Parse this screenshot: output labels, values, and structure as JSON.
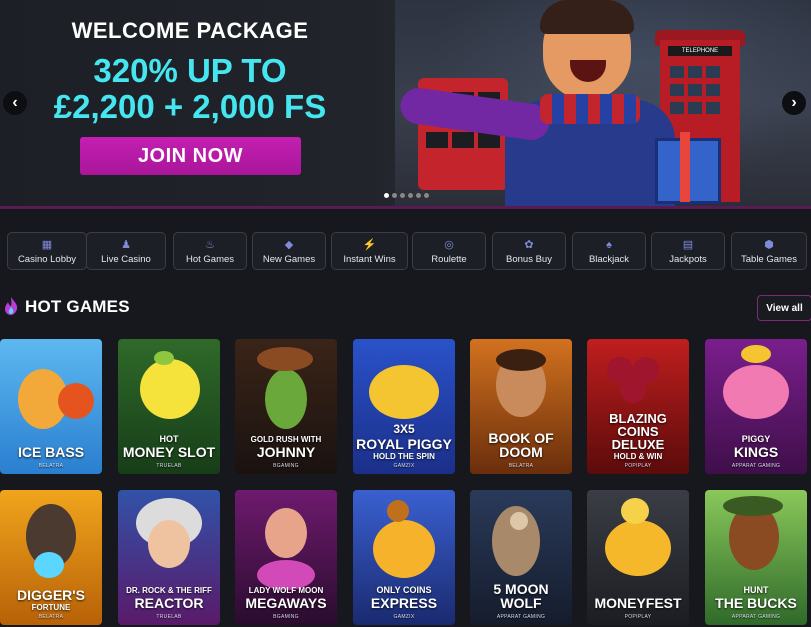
{
  "hero": {
    "title_line1": "WELCOME PACKAGE",
    "title_line2": "320% UP TO",
    "title_line3": "£2,200 + 2,000 FS",
    "cta_label": "JOIN NOW",
    "prev_arrow": "‹",
    "next_arrow": "›",
    "slides_count": 6,
    "active_slide": 1,
    "booth_sign": "TELEPHONE",
    "accent_color": "#46e6f0",
    "cta_color": "#c41fb1"
  },
  "categories": [
    {
      "label": "Casino Lobby",
      "icon": "lobby-icon"
    },
    {
      "label": "Live Casino",
      "icon": "dealer-icon"
    },
    {
      "label": "Hot Games",
      "icon": "flame-icon"
    },
    {
      "label": "New Games",
      "icon": "diamond-icon"
    },
    {
      "label": "Instant Wins",
      "icon": "lightning-icon"
    },
    {
      "label": "Roulette",
      "icon": "roulette-icon"
    },
    {
      "label": "Bonus Buy",
      "icon": "bonus-icon"
    },
    {
      "label": "Blackjack",
      "icon": "cards-icon"
    },
    {
      "label": "Jackpots",
      "icon": "jackpot-icon"
    },
    {
      "label": "Table Games",
      "icon": "dice-icon"
    }
  ],
  "section": {
    "title": "HOT GAMES",
    "view_all_label": "View all"
  },
  "games": [
    {
      "title": "ICE BASS",
      "provider": "BELATRA"
    },
    {
      "title": "MONEY SLOT",
      "pre": "HOT",
      "provider": "TRUELAB"
    },
    {
      "title": "JOHNNY",
      "pre": "GOLD RUSH WITH",
      "provider": "BGAMING"
    },
    {
      "title": "ROYAL PIGGY",
      "pre": "3X5",
      "sub": "HOLD THE SPIN",
      "provider": "GAMZIX"
    },
    {
      "title": "BOOK OF DOOM",
      "provider": "BELATRA"
    },
    {
      "title": "BLAZING COINS DELUXE",
      "sub": "HOLD & WIN",
      "provider": "POPIPLAY"
    },
    {
      "title": "KINGS",
      "pre": "PIGGY",
      "provider": "APPARAT GAMING"
    },
    {
      "title": "DIGGER'S",
      "sub": "FORTUNE",
      "provider": "BELATRA"
    },
    {
      "title": "REACTOR",
      "pre": "DR. ROCK & THE RIFF",
      "provider": "TRUELAB"
    },
    {
      "title": "MEGAWAYS",
      "pre": "LADY WOLF MOON",
      "provider": "BGAMING"
    },
    {
      "title": "EXPRESS",
      "pre": "ONLY COINS",
      "provider": "GAMZIX"
    },
    {
      "title": "5 MOON WOLF",
      "provider": "APPARAT GAMING"
    },
    {
      "title": "MONEYFEST",
      "provider": "POPIPLAY"
    },
    {
      "title": "THE BUCKS",
      "pre": "HUNT",
      "provider": "APPARAT GAMING"
    }
  ]
}
